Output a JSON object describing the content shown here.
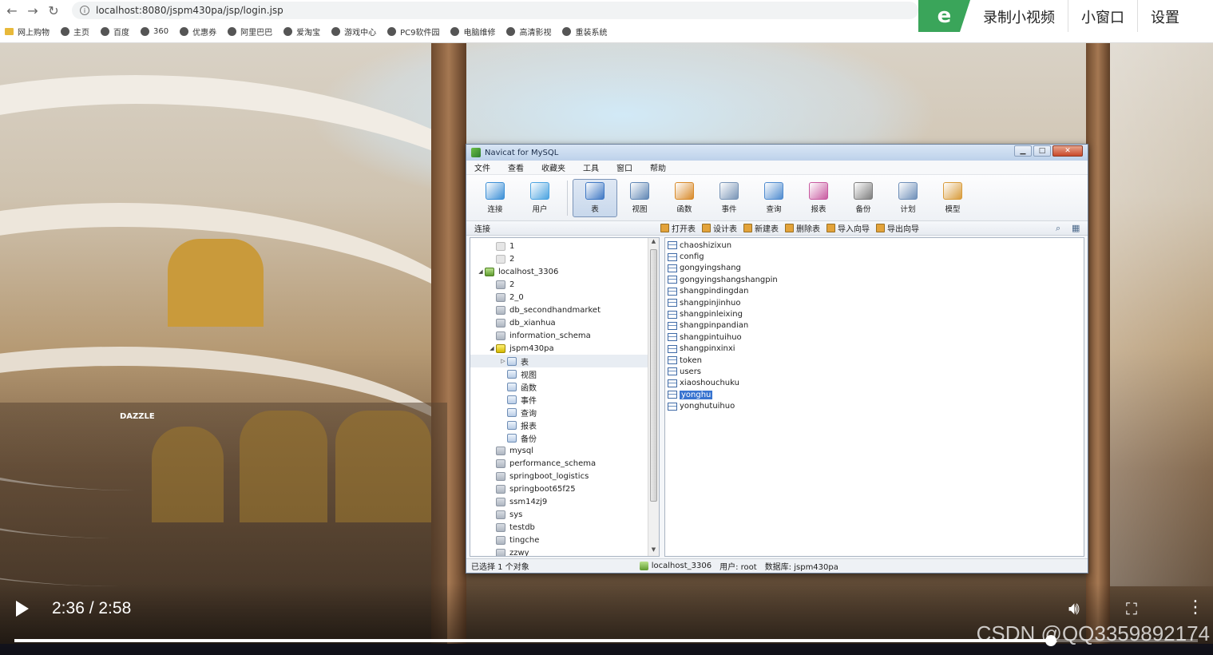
{
  "browser": {
    "url": "localhost:8080/jspm430pa/jsp/login.jsp",
    "bookmarks": [
      "网上购物",
      "主页",
      "百度",
      "360",
      "优惠券",
      "阿里巴巴",
      "爱淘宝",
      "游戏中心",
      "PC9软件园",
      "电脑维修",
      "高清影视",
      "重装系统"
    ]
  },
  "video_tools": {
    "logo": "e",
    "record": "录制小视频",
    "mini": "小窗口",
    "settings": "设置"
  },
  "navicat": {
    "title": "Navicat for MySQL",
    "menu": [
      "文件",
      "查看",
      "收藏夹",
      "工具",
      "窗口",
      "帮助"
    ],
    "toolbar": [
      {
        "label": "连接",
        "color": "#3b8fd6"
      },
      {
        "label": "用户",
        "color": "#4aa3e0"
      },
      {
        "label": "表",
        "color": "#3f78c4"
      },
      {
        "label": "视图",
        "color": "#5f86b4"
      },
      {
        "label": "函数",
        "color": "#d88a2a"
      },
      {
        "label": "事件",
        "color": "#7894b6"
      },
      {
        "label": "查询",
        "color": "#4f8bcf"
      },
      {
        "label": "报表",
        "color": "#c85aa0"
      },
      {
        "label": "备份",
        "color": "#7d7d7d"
      },
      {
        "label": "计划",
        "color": "#6e8fb8"
      },
      {
        "label": "模型",
        "color": "#d89b3a"
      }
    ],
    "subbar_left": "连接",
    "actions": [
      "打开表",
      "设计表",
      "新建表",
      "删除表",
      "导入向导",
      "导出向导"
    ],
    "tree": [
      {
        "label": "1",
        "level": 1,
        "icon": "grey",
        "tw": ""
      },
      {
        "label": "2",
        "level": 1,
        "icon": "grey",
        "tw": ""
      },
      {
        "label": "localhost_3306",
        "level": 0,
        "icon": "conn",
        "tw": "◢"
      },
      {
        "label": "2",
        "level": 1,
        "icon": "db",
        "tw": ""
      },
      {
        "label": "2_0",
        "level": 1,
        "icon": "db",
        "tw": ""
      },
      {
        "label": "db_secondhandmarket",
        "level": 1,
        "icon": "db",
        "tw": ""
      },
      {
        "label": "db_xianhua",
        "level": 1,
        "icon": "db",
        "tw": ""
      },
      {
        "label": "information_schema",
        "level": 1,
        "icon": "db",
        "tw": ""
      },
      {
        "label": "jspm430pa",
        "level": 1,
        "icon": "dbopen",
        "tw": "◢"
      },
      {
        "label": "表",
        "level": 2,
        "icon": "obj",
        "tw": "▷",
        "sel": true
      },
      {
        "label": "视图",
        "level": 2,
        "icon": "obj",
        "tw": ""
      },
      {
        "label": "函数",
        "level": 2,
        "icon": "obj",
        "tw": ""
      },
      {
        "label": "事件",
        "level": 2,
        "icon": "obj",
        "tw": ""
      },
      {
        "label": "查询",
        "level": 2,
        "icon": "obj",
        "tw": ""
      },
      {
        "label": "报表",
        "level": 2,
        "icon": "obj",
        "tw": ""
      },
      {
        "label": "备份",
        "level": 2,
        "icon": "obj",
        "tw": ""
      },
      {
        "label": "mysql",
        "level": 1,
        "icon": "db",
        "tw": ""
      },
      {
        "label": "performance_schema",
        "level": 1,
        "icon": "db",
        "tw": ""
      },
      {
        "label": "springboot_logistics",
        "level": 1,
        "icon": "db",
        "tw": ""
      },
      {
        "label": "springboot65f25",
        "level": 1,
        "icon": "db",
        "tw": ""
      },
      {
        "label": "ssm14zj9",
        "level": 1,
        "icon": "db",
        "tw": ""
      },
      {
        "label": "sys",
        "level": 1,
        "icon": "db",
        "tw": ""
      },
      {
        "label": "testdb",
        "level": 1,
        "icon": "db",
        "tw": ""
      },
      {
        "label": "tingche",
        "level": 1,
        "icon": "db",
        "tw": ""
      },
      {
        "label": "zzwy",
        "level": 1,
        "icon": "db",
        "tw": ""
      }
    ],
    "tables": [
      "chaoshizixun",
      "config",
      "gongyingshang",
      "gongyingshangshangpin",
      "shangpindingdan",
      "shangpinjinhuo",
      "shangpinleixing",
      "shangpinpandian",
      "shangpintuihuo",
      "shangpinxinxi",
      "token",
      "users",
      "xiaoshouchuku",
      "yonghu",
      "yonghutuihuo"
    ],
    "selected_table": "yonghu",
    "status": {
      "selection": "已选择 1 个对象",
      "conn": "localhost_3306",
      "user": "用户: root",
      "db": "数据库: jspm430pa"
    }
  },
  "video": {
    "time": "2:36 / 2:58",
    "progress": 0.876,
    "watermark": "CSDN @QQ3359892174"
  }
}
